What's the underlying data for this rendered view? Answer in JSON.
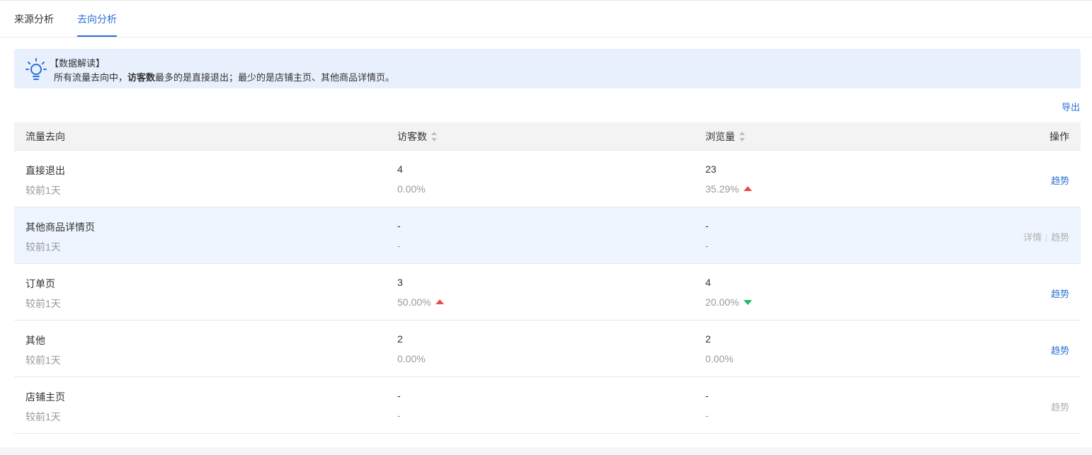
{
  "tabs": [
    {
      "label": "来源分析",
      "active": false
    },
    {
      "label": "去向分析",
      "active": true
    }
  ],
  "notice": {
    "icon": "bulb-icon",
    "title": "【数据解读】",
    "desc_prefix": "所有流量去向中，",
    "desc_bold": "访客数",
    "desc_suffix": "最多的是直接退出；最少的是店铺主页、其他商品详情页。"
  },
  "export_label": "导出",
  "table": {
    "headers": {
      "destination": "流量去向",
      "visitors": "访客数",
      "pageviews": "浏览量",
      "actions": "操作"
    },
    "rows": [
      {
        "name": "直接退出",
        "compare": "较前1天",
        "visitors": "4",
        "visitors_change": "0.00%",
        "visitors_trend": "",
        "pageviews": "23",
        "pageviews_change": "35.29%",
        "pageviews_trend": "up",
        "detail": "",
        "trend_label": "趋势",
        "trend_enabled": true
      },
      {
        "name": "其他商品详情页",
        "compare": "较前1天",
        "visitors": "-",
        "visitors_change": "-",
        "visitors_trend": "",
        "pageviews": "-",
        "pageviews_change": "-",
        "pageviews_trend": "",
        "detail": "详情",
        "trend_label": "趋势",
        "trend_enabled": false
      },
      {
        "name": "订单页",
        "compare": "较前1天",
        "visitors": "3",
        "visitors_change": "50.00%",
        "visitors_trend": "up",
        "pageviews": "4",
        "pageviews_change": "20.00%",
        "pageviews_trend": "down",
        "detail": "",
        "trend_label": "趋势",
        "trend_enabled": true
      },
      {
        "name": "其他",
        "compare": "较前1天",
        "visitors": "2",
        "visitors_change": "0.00%",
        "visitors_trend": "",
        "pageviews": "2",
        "pageviews_change": "0.00%",
        "pageviews_trend": "",
        "detail": "",
        "trend_label": "趋势",
        "trend_enabled": true
      },
      {
        "name": "店铺主页",
        "compare": "较前1天",
        "visitors": "-",
        "visitors_change": "-",
        "visitors_trend": "",
        "pageviews": "-",
        "pageviews_change": "-",
        "pageviews_trend": "",
        "detail": "",
        "trend_label": "趋势",
        "trend_enabled": false
      }
    ]
  },
  "colors": {
    "accent": "#2d6fd8",
    "up": "#f04848",
    "down": "#1fb86a",
    "notice_bg": "#e8f0fd"
  }
}
